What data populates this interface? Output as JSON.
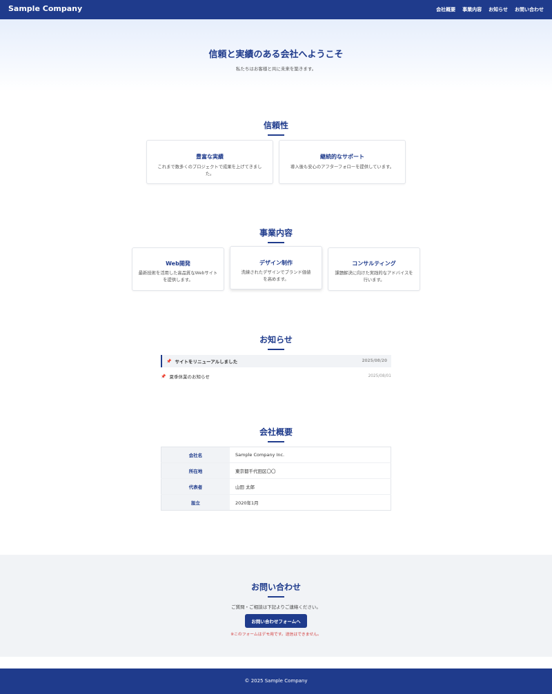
{
  "header": {
    "logo": "Sample Company",
    "nav": [
      "会社概要",
      "事業内容",
      "お知らせ",
      "お問い合わせ"
    ]
  },
  "hero": {
    "title": "信頼と実績のある会社へようこそ",
    "subtitle": "私たちはお客様と共に未来を築きます。"
  },
  "reliability": {
    "title": "信頼性",
    "cards": [
      {
        "title": "豊富な実績",
        "text": "これまで数多くのプロジェクトで成果を上げてきました。"
      },
      {
        "title": "継続的なサポート",
        "text": "導入後も安心のアフターフォローを提供しています。"
      }
    ]
  },
  "business": {
    "title": "事業内容",
    "cards": [
      {
        "title": "Web開発",
        "text": "最新技術を活用した高品質なWebサイトを提供します。"
      },
      {
        "title": "デザイン制作",
        "text": "洗練されたデザインでブランド価値を高めます。"
      },
      {
        "title": "コンサルティング",
        "text": "課題解決に向けた実践的なアドバイスを行います。"
      }
    ]
  },
  "news": {
    "title": "お知らせ",
    "items": [
      {
        "text": "サイトをリニューアルしました",
        "date": "2025/08/20"
      },
      {
        "text": "夏季休業のお知らせ",
        "date": "2025/08/01"
      }
    ]
  },
  "company": {
    "title": "会社概要",
    "rows": [
      {
        "key": "会社名",
        "value": "Sample Company Inc."
      },
      {
        "key": "所在地",
        "value": "東京都千代田区〇〇"
      },
      {
        "key": "代表者",
        "value": "山田 太郎"
      },
      {
        "key": "設立",
        "value": "2020年1月"
      }
    ]
  },
  "contact": {
    "title": "お問い合わせ",
    "text": "ご質問・ご相談は下記よりご連絡ください。",
    "button": "お問い合わせフォームへ",
    "note": "※このフォームはデモ用です。送信はできません。"
  },
  "footer": {
    "copyright": "© 2025 Sample Company"
  },
  "colors": {
    "brand": "#1f3b8c",
    "note": "#d23b3b"
  }
}
